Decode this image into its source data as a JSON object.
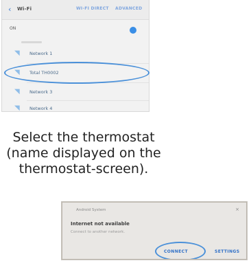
{
  "wifi_screen": {
    "back_icon": "back-arrow-icon",
    "title": "Wi-Fi",
    "actions": [
      "WI-FI DIRECT",
      "ADVANCED"
    ],
    "toggle_label": "ON",
    "toggle_state": "on",
    "networks": [
      {
        "label": "Network 1",
        "icon": "wifi-icon"
      },
      {
        "label": "Total TH0002",
        "icon": "wifi-icon",
        "highlighted": true
      },
      {
        "label": "Network 3",
        "icon": "wifi-icon"
      },
      {
        "label": "Network 4",
        "icon": "wifi-icon"
      }
    ],
    "highlight_color": "#4a90d9"
  },
  "instruction": {
    "line1": "Select the  thermostat",
    "line2": "(name displayed on the",
    "line3": "thermostat-screen)."
  },
  "dialog": {
    "title": "Android System",
    "heading": "Internet not available",
    "body": "Connect to another network.",
    "buttons": [
      "CONNECT",
      "SETTINGS"
    ],
    "highlight_color": "#4a90d9"
  }
}
